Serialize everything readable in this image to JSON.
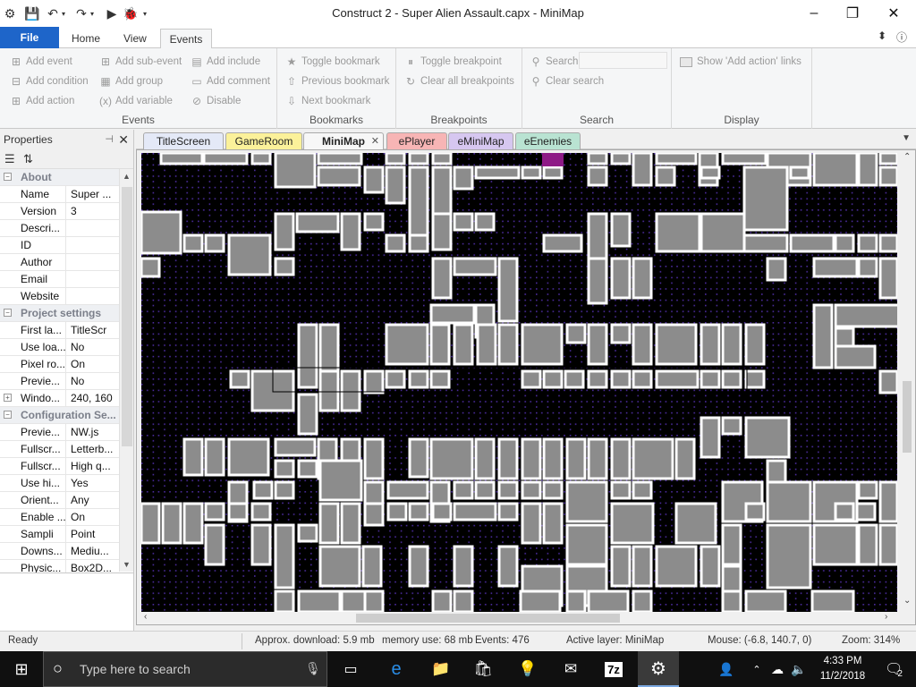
{
  "window": {
    "title": "Construct 2 - Super Alien Assault.capx - MiniMap",
    "minimize": "–",
    "maximize": "❐",
    "close": "✕"
  },
  "ribbon_tabs": [
    "File",
    "Home",
    "View",
    "Events"
  ],
  "ribbon_active_tab": "Events",
  "ribbon": {
    "events": {
      "label": "Events",
      "add_event": "Add event",
      "add_sub_event": "Add sub-event",
      "add_include": "Add include",
      "add_condition": "Add condition",
      "add_group": "Add group",
      "add_comment": "Add comment",
      "add_action": "Add action",
      "add_variable": "Add variable",
      "disable": "Disable"
    },
    "bookmarks": {
      "label": "Bookmarks",
      "toggle": "Toggle bookmark",
      "previous": "Previous bookmark",
      "next": "Next bookmark"
    },
    "breakpoints": {
      "label": "Breakpoints",
      "toggle": "Toggle breakpoint",
      "clear_all": "Clear all breakpoints"
    },
    "search": {
      "label": "Search",
      "search": "Search",
      "clear": "Clear search",
      "value": ""
    },
    "display": {
      "label": "Display",
      "show_add_action_links": "Show 'Add action' links",
      "checked": false
    }
  },
  "properties": {
    "title": "Properties",
    "categories": [
      {
        "name": "About",
        "rows": [
          {
            "k": "Name",
            "v": "Super ..."
          },
          {
            "k": "Version",
            "v": "3"
          },
          {
            "k": "Descri...",
            "v": ""
          },
          {
            "k": "ID",
            "v": ""
          },
          {
            "k": "Author",
            "v": ""
          },
          {
            "k": "Email",
            "v": ""
          },
          {
            "k": "Website",
            "v": ""
          }
        ]
      },
      {
        "name": "Project settings",
        "rows": [
          {
            "k": "First la...",
            "v": "TitleScr"
          },
          {
            "k": "Use loa...",
            "v": "No"
          },
          {
            "k": "Pixel ro...",
            "v": "On"
          },
          {
            "k": "Previe...",
            "v": "No"
          },
          {
            "k": "Windo...",
            "v": "240, 160",
            "expandable": true
          }
        ]
      },
      {
        "name": "Configuration Se...",
        "rows": [
          {
            "k": "Previe...",
            "v": "NW.js"
          },
          {
            "k": "Fullscr...",
            "v": "Letterb..."
          },
          {
            "k": "Fullscr...",
            "v": "High q..."
          },
          {
            "k": "Use hi...",
            "v": "Yes"
          },
          {
            "k": "Orient...",
            "v": "Any"
          },
          {
            "k": "Enable ...",
            "v": "On"
          },
          {
            "k": "Sampli",
            "v": "Point"
          },
          {
            "k": "Downs...",
            "v": "Mediu..."
          },
          {
            "k": "Physic...",
            "v": "Box2D..."
          }
        ]
      }
    ]
  },
  "doc_tabs": [
    {
      "label": "TitleScreen",
      "color": "#e4e9f7"
    },
    {
      "label": "GameRoom",
      "color": "#fbf19a"
    },
    {
      "label": "MiniMap",
      "color": "#eeeeee",
      "active": true
    },
    {
      "label": "ePlayer",
      "color": "#f7b5b5"
    },
    {
      "label": "eMiniMap",
      "color": "#d6c7f0"
    },
    {
      "label": "eEnemies",
      "color": "#b9e3d2"
    }
  ],
  "colors": {
    "ribbon_file": "#1e65c9",
    "canvas_bg": "#000000",
    "grid_dot": "#4a2b9c",
    "block_fill": "#8c8c8c",
    "block_border": "#ffffff",
    "marker": "#8e1a86"
  },
  "status": {
    "ready": "Ready",
    "download": "Approx. download: 5.9 mb",
    "memory": "memory use: 68 mb",
    "events": "Events: 476",
    "active_layer": "Active layer: MiniMap",
    "mouse": "Mouse: (-6.8, 140.7, 0)",
    "zoom": "Zoom: 314%"
  },
  "taskbar": {
    "search_placeholder": "Type here to search",
    "time": "4:33 PM",
    "date": "11/2/2018",
    "notifications": "2"
  }
}
